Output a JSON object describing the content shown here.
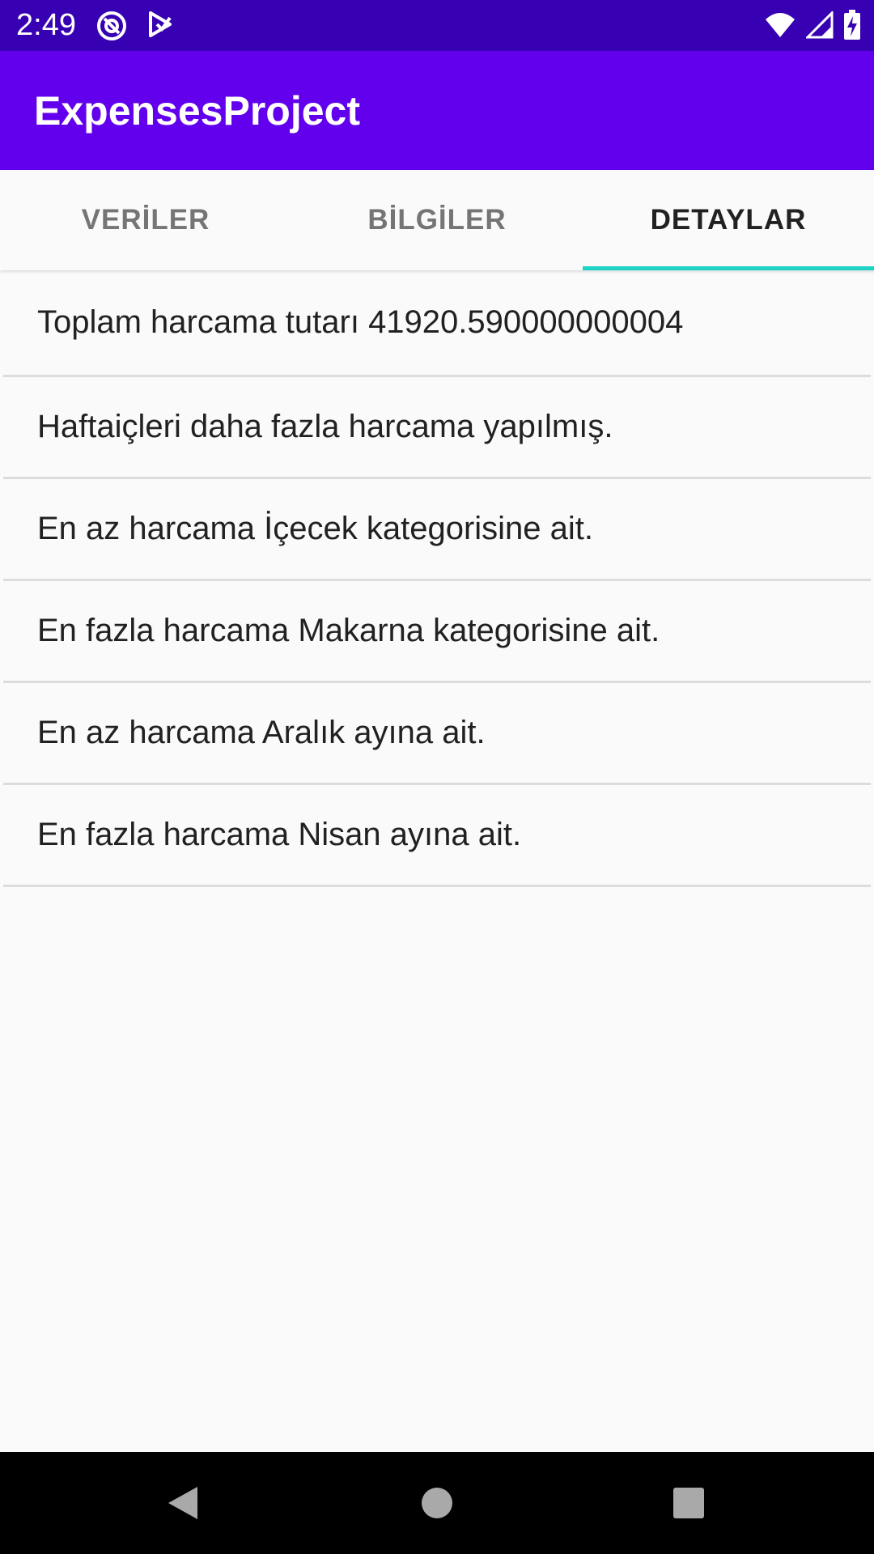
{
  "status_bar": {
    "time": "2:49",
    "left_icons": [
      "at-sign-icon",
      "play-store-icon"
    ],
    "right_icons": [
      "wifi-icon",
      "signal-icon",
      "battery-charging-icon"
    ]
  },
  "app_bar": {
    "title": "ExpensesProject"
  },
  "tabs": [
    {
      "label": "VERİLER",
      "active": false
    },
    {
      "label": "BİLGİLER",
      "active": false
    },
    {
      "label": "DETAYLAR",
      "active": true
    }
  ],
  "details": [
    "Toplam harcama tutarı 41920.590000000004",
    "Haftaiçleri daha fazla harcama yapılmış.",
    "En az harcama İçecek kategorisine ait.",
    "En fazla harcama Makarna kategorisine ait.",
    "En az harcama Aralık ayına ait.",
    "En fazla harcama Nisan ayına ait."
  ],
  "nav_bar": {
    "buttons": [
      "back-icon",
      "home-icon",
      "recents-icon"
    ]
  },
  "colors": {
    "status_bar": "#3700b3",
    "app_bar": "#6200ee",
    "tab_indicator": "#1fd3c6",
    "background": "#fafafa"
  }
}
